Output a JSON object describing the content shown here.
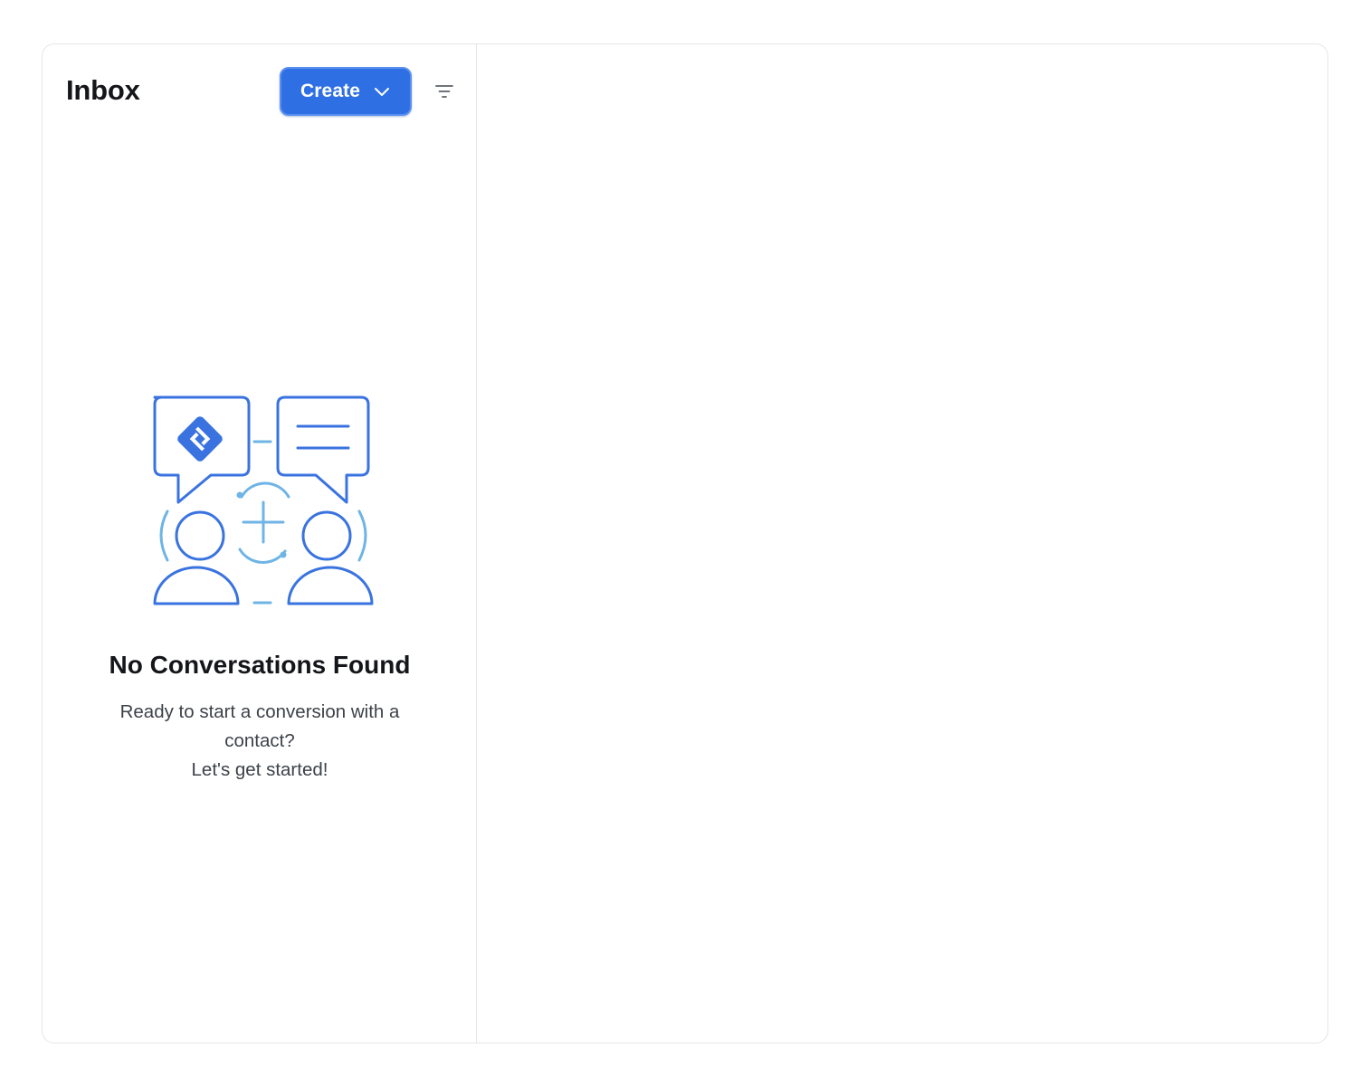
{
  "inbox": {
    "title": "Inbox",
    "create_label": "Create",
    "filter_icon": "filter-icon"
  },
  "empty_state": {
    "title": "No Conversations Found",
    "line1": "Ready to start a conversion with a contact?",
    "line2": "Let's get started!",
    "illustration_icon": "two-people-chat-illustration"
  },
  "colors": {
    "accent": "#2f6fe4",
    "illustration_primary": "#3a73e0",
    "illustration_secondary": "#6fb4e6"
  }
}
